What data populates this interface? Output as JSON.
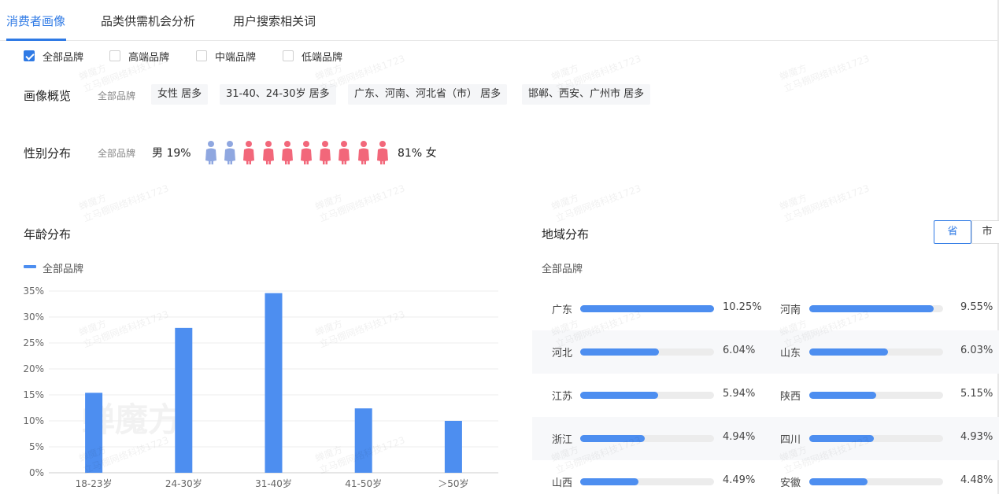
{
  "tabs": [
    {
      "label": "消费者画像",
      "active": true
    },
    {
      "label": "品类供需机会分析",
      "active": false
    },
    {
      "label": "用户搜索相关词",
      "active": false
    }
  ],
  "filters": [
    {
      "label": "全部品牌",
      "checked": true
    },
    {
      "label": "高端品牌",
      "checked": false
    },
    {
      "label": "中端品牌",
      "checked": false
    },
    {
      "label": "低端品牌",
      "checked": false
    }
  ],
  "overview": {
    "title": "画像概览",
    "brand": "全部品牌",
    "chips": [
      "女性 居多",
      "31-40、24-30岁 居多",
      "广东、河南、河北省（市） 居多",
      "邯郸、西安、广州市 居多"
    ]
  },
  "gender": {
    "title": "性别分布",
    "brand": "全部品牌",
    "male_label": "男 19%",
    "female_label": "81% 女",
    "male_icons": 2,
    "female_icons": 8,
    "male_color": "#8fa7e0",
    "female_color": "#f2677a"
  },
  "age": {
    "title": "年龄分布",
    "legend": "全部品牌"
  },
  "region": {
    "title": "地域分布",
    "brand": "全部品牌",
    "toggle_province": "省",
    "toggle_city": "市",
    "items": [
      {
        "name": "广东",
        "value": 10.25,
        "label": "10.25%"
      },
      {
        "name": "河南",
        "value": 9.55,
        "label": "9.55%"
      },
      {
        "name": "河北",
        "value": 6.04,
        "label": "6.04%"
      },
      {
        "name": "山东",
        "value": 6.03,
        "label": "6.03%"
      },
      {
        "name": "江苏",
        "value": 5.94,
        "label": "5.94%"
      },
      {
        "name": "陕西",
        "value": 5.15,
        "label": "5.15%"
      },
      {
        "name": "浙江",
        "value": 4.94,
        "label": "4.94%"
      },
      {
        "name": "四川",
        "value": 4.93,
        "label": "4.93%"
      },
      {
        "name": "山西",
        "value": 4.49,
        "label": "4.49%"
      },
      {
        "name": "安徽",
        "value": 4.48,
        "label": "4.48%"
      }
    ]
  },
  "watermark": {
    "line1": "蝉魔方",
    "line2": "立马棚网络科技1723",
    "logo": "蝉魔方"
  },
  "colors": {
    "accent": "#2f7ae5",
    "bar": "#4d8ef0"
  },
  "chart_data": {
    "type": "bar",
    "categories": [
      "18-23岁",
      "24-30岁",
      "31-40岁",
      "41-50岁",
      "＞50岁"
    ],
    "series": [
      {
        "name": "全部品牌",
        "values": [
          15.4,
          27.9,
          34.6,
          12.4,
          10.0
        ]
      }
    ],
    "yticks": [
      "0%",
      "5%",
      "10%",
      "15%",
      "20%",
      "25%",
      "30%",
      "35%"
    ],
    "ylim": [
      0,
      35
    ],
    "grid": true,
    "legend": "top-left"
  }
}
